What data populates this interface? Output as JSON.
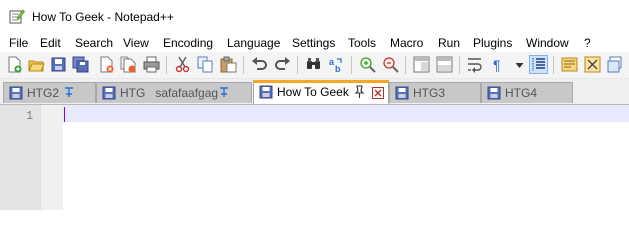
{
  "window": {
    "title": "How To Geek - Notepad++"
  },
  "menu": [
    "File",
    "Edit",
    "Search",
    "View",
    "Encoding",
    "Language",
    "Settings",
    "Tools",
    "Macro",
    "Run",
    "Plugins",
    "Window",
    "?"
  ],
  "toolbar": {
    "buttons": [
      "new-file-icon",
      "open-file-icon",
      "save-icon",
      "save-all-icon",
      "close-icon",
      "close-all-icon",
      "print-icon",
      "cut-icon",
      "copy-icon",
      "paste-icon",
      "undo-icon",
      "redo-icon",
      "find-icon",
      "replace-icon",
      "zoom-in-icon",
      "zoom-out-icon",
      "sync-vertical-icon",
      "sync-horizontal-icon",
      "word-wrap-icon",
      "show-all-characters-icon",
      "dropdown-icon",
      "indent-guide-icon",
      "document-map-icon",
      "function-list-icon",
      "folder-as-workspace-icon"
    ],
    "active_button": "indent-guide-icon"
  },
  "tabs": [
    {
      "label": "HTG2",
      "pinned": true,
      "active": false
    },
    {
      "label": "HTG   safafaafgag",
      "pinned": true,
      "active": false
    },
    {
      "label": "How To Geek",
      "pinned": true,
      "active": true
    },
    {
      "label": "HTG3",
      "pinned": false,
      "active": false
    },
    {
      "label": "HTG4",
      "pinned": false,
      "active": false
    }
  ],
  "editor": {
    "line_numbers": [
      "1"
    ],
    "content": ""
  },
  "colors": {
    "active_tab_accent": "#f5a623",
    "caret": "#8000ff",
    "current_line": "#e8e8ff",
    "save_icon": "#5b6fb5"
  }
}
